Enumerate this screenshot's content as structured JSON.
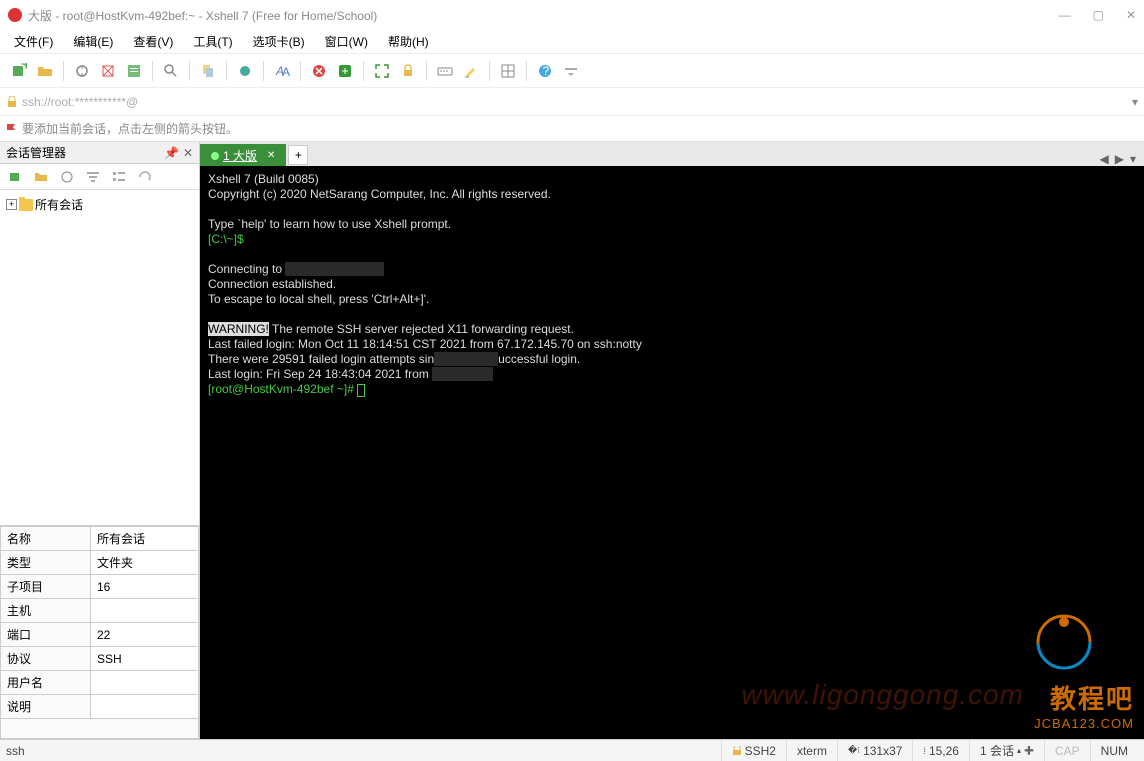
{
  "title": "大版 - root@HostKvm-492bef:~ - Xshell 7 (Free for Home/School)",
  "menu": [
    "文件(F)",
    "编辑(E)",
    "查看(V)",
    "工具(T)",
    "选项卡(B)",
    "窗口(W)",
    "帮助(H)"
  ],
  "addr": "ssh://root:***********@",
  "sess_hint": "要添加当前会话，点击左侧的箭头按钮。",
  "sidebar": {
    "title": "会话管理器",
    "root": "所有会话"
  },
  "props": [
    {
      "k": "名称",
      "v": "所有会话"
    },
    {
      "k": "类型",
      "v": "文件夹"
    },
    {
      "k": "子项目",
      "v": "16"
    },
    {
      "k": "主机",
      "v": ""
    },
    {
      "k": "端口",
      "v": "22"
    },
    {
      "k": "协议",
      "v": "SSH"
    },
    {
      "k": "用户名",
      "v": ""
    },
    {
      "k": "说明",
      "v": ""
    }
  ],
  "tab": {
    "label": "1 大版",
    "add": "+"
  },
  "term": {
    "l1": "Xshell 7 (Build 0085)",
    "l2": "Copyright (c) 2020 NetSarang Computer, Inc. All rights reserved.",
    "l3": "Type `help' to learn how to use Xshell prompt.",
    "l4": "[C:\\~]$",
    "l5a": "Connecting to ",
    "l6": "Connection established.",
    "l7": "To escape to local shell, press 'Ctrl+Alt+]'.",
    "w": "WARNING!",
    "l8": " The remote SSH server rejected X11 forwarding request.",
    "l9": "Last failed login: Mon Oct 11 18:14:51 CST 2021 from 67.172.145.70 on ssh:notty",
    "l10a": "There were 29591 failed login attempts sin",
    "l10b": "uccessful login.",
    "l11": "Last login: Fri Sep 24 18:43:04 2021 from ",
    "l12": "[root@HostKvm-492bef ~]# "
  },
  "status": {
    "left": "ssh",
    "ssh": "SSH2",
    "term": "xterm",
    "size": "131x37",
    "pos": "15,26",
    "sess": "1 会话",
    "cap": "CAP",
    "num": "NUM"
  },
  "wm": {
    "t1": "教程吧",
    "t2": "JCBA123.COM",
    "url": "www.ligonggong.com"
  }
}
